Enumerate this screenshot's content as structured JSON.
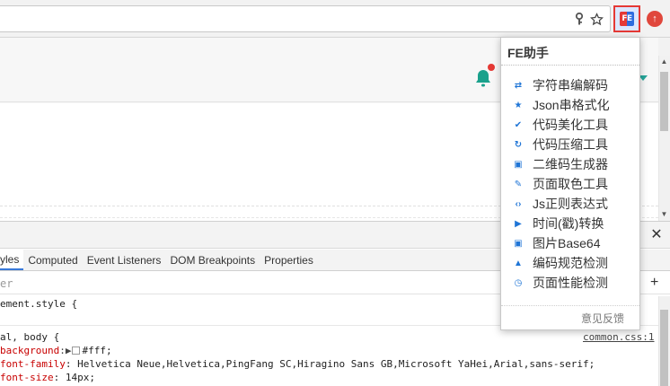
{
  "toolbar": {
    "omnibox_icons": [
      "key-icon",
      "star-icon"
    ],
    "extensions": [
      {
        "name": "fe-helper-extension",
        "logo_text": "FE",
        "colors": [
          "#e53935",
          "#2d6cdf"
        ]
      },
      {
        "name": "upload-extension",
        "glyph": "↑",
        "color": "#e0473c"
      }
    ]
  },
  "page": {
    "notification_badge_color": "#e53935",
    "bell_color": "#1aa18c",
    "accent": "#26a69a"
  },
  "devtools": {
    "tabs": [
      {
        "label": "yles",
        "active": true
      },
      {
        "label": "Computed"
      },
      {
        "label": "Event Listeners"
      },
      {
        "label": "DOM Breakpoints"
      },
      {
        "label": "Properties"
      }
    ],
    "filter_placeholder": "er",
    "close_glyph": "✕",
    "plus_glyph": "+",
    "element_style": "ement.style {",
    "selector": "al, body {",
    "source": "common.css:1",
    "declarations": [
      {
        "prop": "background",
        "value": "#fff",
        "has_swatch": true
      },
      {
        "prop": "font-family",
        "value": "Helvetica Neue,Helvetica,PingFang SC,Hiragino Sans GB,Microsoft YaHei,Arial,sans-serif"
      },
      {
        "prop": "font-size",
        "value": "14px"
      }
    ]
  },
  "popup": {
    "title": "FE助手",
    "items": [
      {
        "label": "字符串编解码",
        "icon": "swap-arrows-icon",
        "glyph": "⇄"
      },
      {
        "label": "Json串格式化",
        "icon": "star-icon",
        "glyph": "★"
      },
      {
        "label": "代码美化工具",
        "icon": "check-icon",
        "glyph": "✔"
      },
      {
        "label": "代码压缩工具",
        "icon": "refresh-icon",
        "glyph": "↻"
      },
      {
        "label": "二维码生成器",
        "icon": "qrcode-icon",
        "glyph": "▣"
      },
      {
        "label": "页面取色工具",
        "icon": "eyedropper-icon",
        "glyph": "✎"
      },
      {
        "label": "Js正则表达式",
        "icon": "code-icon",
        "glyph": "‹›"
      },
      {
        "label": "时间(戳)转换",
        "icon": "play-icon",
        "glyph": "▶"
      },
      {
        "label": "图片Base64",
        "icon": "image-icon",
        "glyph": "▣"
      },
      {
        "label": "编码规范检测",
        "icon": "warning-icon",
        "glyph": "▲"
      },
      {
        "label": "页面性能检测",
        "icon": "clock-icon",
        "glyph": "◷"
      }
    ],
    "feedback": "意见反馈"
  }
}
